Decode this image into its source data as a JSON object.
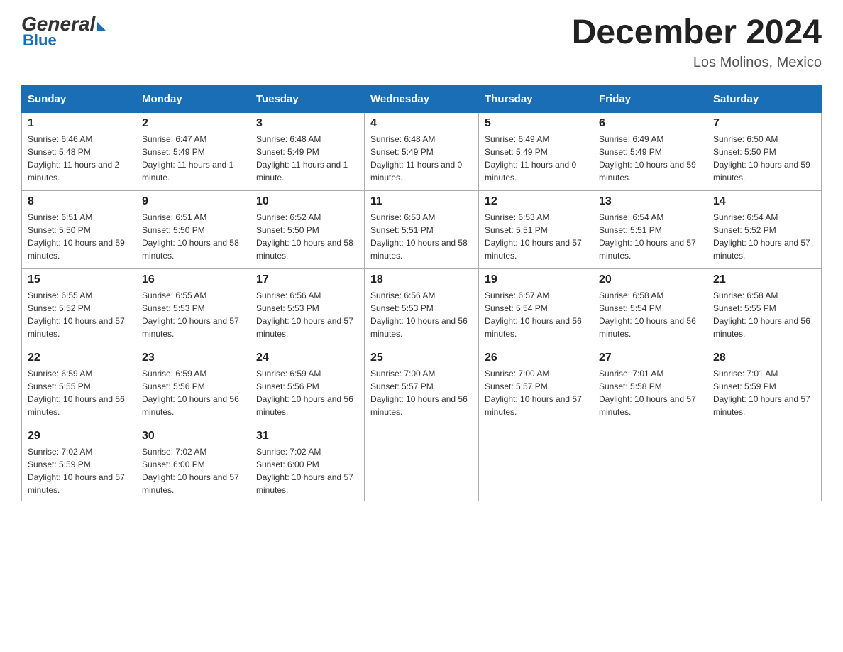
{
  "header": {
    "title": "December 2024",
    "location": "Los Molinos, Mexico",
    "logo_general": "General",
    "logo_blue": "Blue"
  },
  "days_of_week": [
    "Sunday",
    "Monday",
    "Tuesday",
    "Wednesday",
    "Thursday",
    "Friday",
    "Saturday"
  ],
  "weeks": [
    [
      {
        "day": "1",
        "sunrise": "6:46 AM",
        "sunset": "5:48 PM",
        "daylight": "11 hours and 2 minutes."
      },
      {
        "day": "2",
        "sunrise": "6:47 AM",
        "sunset": "5:49 PM",
        "daylight": "11 hours and 1 minute."
      },
      {
        "day": "3",
        "sunrise": "6:48 AM",
        "sunset": "5:49 PM",
        "daylight": "11 hours and 1 minute."
      },
      {
        "day": "4",
        "sunrise": "6:48 AM",
        "sunset": "5:49 PM",
        "daylight": "11 hours and 0 minutes."
      },
      {
        "day": "5",
        "sunrise": "6:49 AM",
        "sunset": "5:49 PM",
        "daylight": "11 hours and 0 minutes."
      },
      {
        "day": "6",
        "sunrise": "6:49 AM",
        "sunset": "5:49 PM",
        "daylight": "10 hours and 59 minutes."
      },
      {
        "day": "7",
        "sunrise": "6:50 AM",
        "sunset": "5:50 PM",
        "daylight": "10 hours and 59 minutes."
      }
    ],
    [
      {
        "day": "8",
        "sunrise": "6:51 AM",
        "sunset": "5:50 PM",
        "daylight": "10 hours and 59 minutes."
      },
      {
        "day": "9",
        "sunrise": "6:51 AM",
        "sunset": "5:50 PM",
        "daylight": "10 hours and 58 minutes."
      },
      {
        "day": "10",
        "sunrise": "6:52 AM",
        "sunset": "5:50 PM",
        "daylight": "10 hours and 58 minutes."
      },
      {
        "day": "11",
        "sunrise": "6:53 AM",
        "sunset": "5:51 PM",
        "daylight": "10 hours and 58 minutes."
      },
      {
        "day": "12",
        "sunrise": "6:53 AM",
        "sunset": "5:51 PM",
        "daylight": "10 hours and 57 minutes."
      },
      {
        "day": "13",
        "sunrise": "6:54 AM",
        "sunset": "5:51 PM",
        "daylight": "10 hours and 57 minutes."
      },
      {
        "day": "14",
        "sunrise": "6:54 AM",
        "sunset": "5:52 PM",
        "daylight": "10 hours and 57 minutes."
      }
    ],
    [
      {
        "day": "15",
        "sunrise": "6:55 AM",
        "sunset": "5:52 PM",
        "daylight": "10 hours and 57 minutes."
      },
      {
        "day": "16",
        "sunrise": "6:55 AM",
        "sunset": "5:53 PM",
        "daylight": "10 hours and 57 minutes."
      },
      {
        "day": "17",
        "sunrise": "6:56 AM",
        "sunset": "5:53 PM",
        "daylight": "10 hours and 57 minutes."
      },
      {
        "day": "18",
        "sunrise": "6:56 AM",
        "sunset": "5:53 PM",
        "daylight": "10 hours and 56 minutes."
      },
      {
        "day": "19",
        "sunrise": "6:57 AM",
        "sunset": "5:54 PM",
        "daylight": "10 hours and 56 minutes."
      },
      {
        "day": "20",
        "sunrise": "6:58 AM",
        "sunset": "5:54 PM",
        "daylight": "10 hours and 56 minutes."
      },
      {
        "day": "21",
        "sunrise": "6:58 AM",
        "sunset": "5:55 PM",
        "daylight": "10 hours and 56 minutes."
      }
    ],
    [
      {
        "day": "22",
        "sunrise": "6:59 AM",
        "sunset": "5:55 PM",
        "daylight": "10 hours and 56 minutes."
      },
      {
        "day": "23",
        "sunrise": "6:59 AM",
        "sunset": "5:56 PM",
        "daylight": "10 hours and 56 minutes."
      },
      {
        "day": "24",
        "sunrise": "6:59 AM",
        "sunset": "5:56 PM",
        "daylight": "10 hours and 56 minutes."
      },
      {
        "day": "25",
        "sunrise": "7:00 AM",
        "sunset": "5:57 PM",
        "daylight": "10 hours and 56 minutes."
      },
      {
        "day": "26",
        "sunrise": "7:00 AM",
        "sunset": "5:57 PM",
        "daylight": "10 hours and 57 minutes."
      },
      {
        "day": "27",
        "sunrise": "7:01 AM",
        "sunset": "5:58 PM",
        "daylight": "10 hours and 57 minutes."
      },
      {
        "day": "28",
        "sunrise": "7:01 AM",
        "sunset": "5:59 PM",
        "daylight": "10 hours and 57 minutes."
      }
    ],
    [
      {
        "day": "29",
        "sunrise": "7:02 AM",
        "sunset": "5:59 PM",
        "daylight": "10 hours and 57 minutes."
      },
      {
        "day": "30",
        "sunrise": "7:02 AM",
        "sunset": "6:00 PM",
        "daylight": "10 hours and 57 minutes."
      },
      {
        "day": "31",
        "sunrise": "7:02 AM",
        "sunset": "6:00 PM",
        "daylight": "10 hours and 57 minutes."
      },
      null,
      null,
      null,
      null
    ]
  ],
  "labels": {
    "sunrise": "Sunrise:",
    "sunset": "Sunset:",
    "daylight": "Daylight:"
  }
}
